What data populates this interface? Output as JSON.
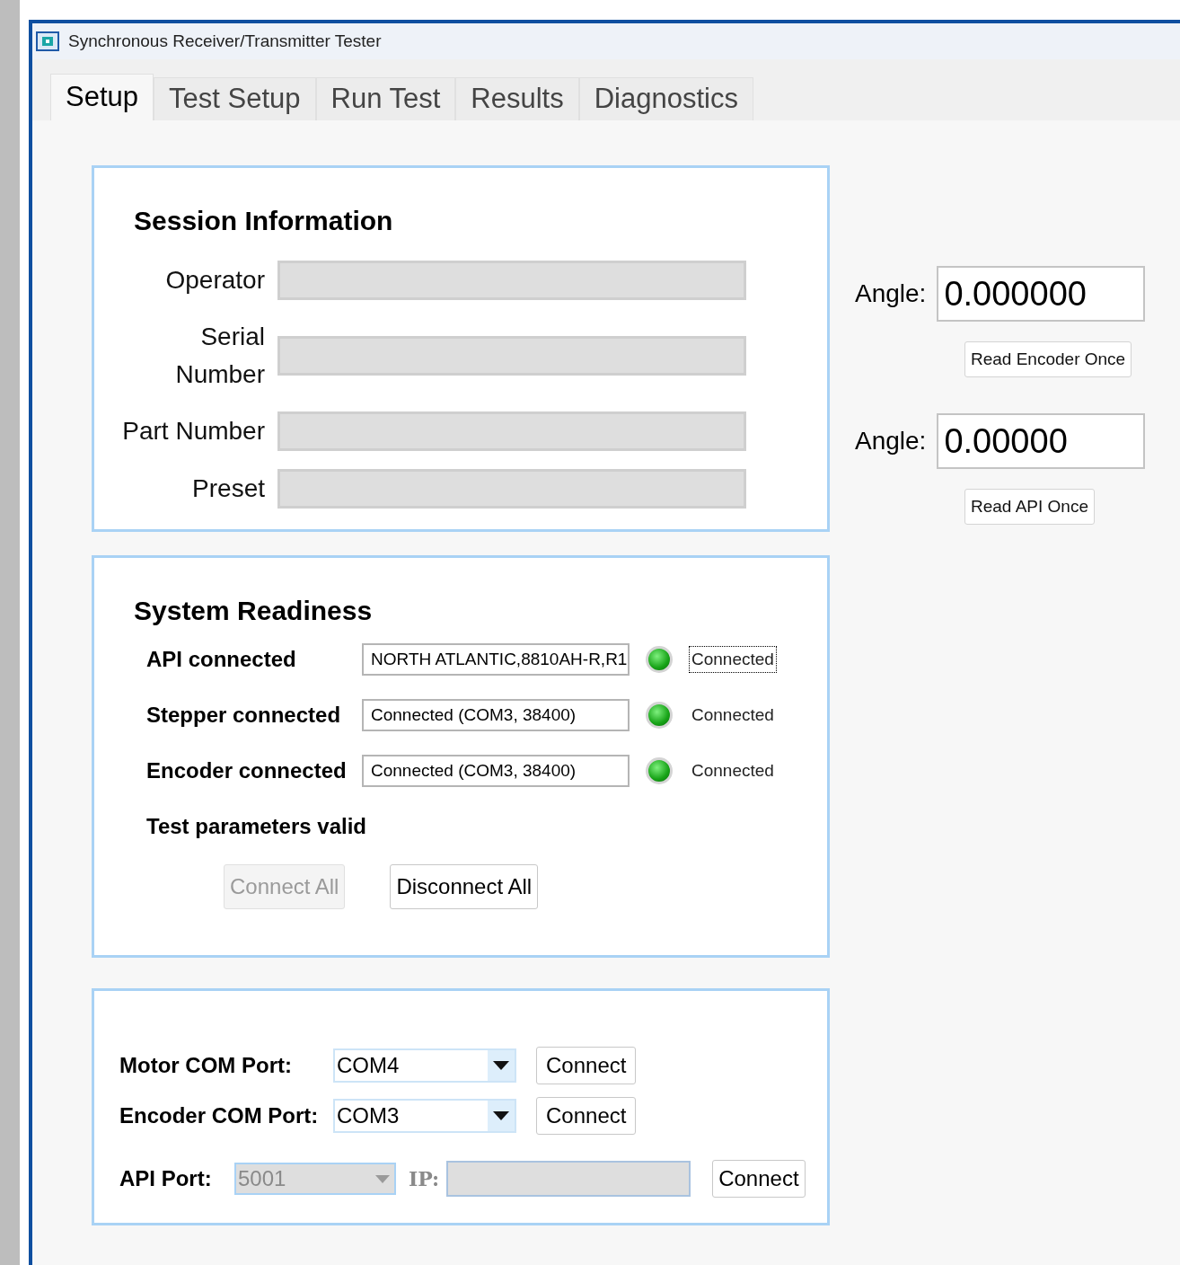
{
  "window": {
    "title": "Synchronous Receiver/Transmitter Tester"
  },
  "tabs": [
    {
      "label": "Setup",
      "selected": true
    },
    {
      "label": "Test Setup",
      "selected": false
    },
    {
      "label": "Run Test",
      "selected": false
    },
    {
      "label": "Results",
      "selected": false
    },
    {
      "label": "Diagnostics",
      "selected": false
    }
  ],
  "session": {
    "title": "Session Information",
    "fields": [
      {
        "label": "Operator",
        "disabled": true
      },
      {
        "label": "Serial Number",
        "disabled": true
      },
      {
        "label": "Part Number",
        "disabled": true
      },
      {
        "label": "Preset",
        "disabled": true
      }
    ]
  },
  "readiness": {
    "title": "System Readiness",
    "rows": [
      {
        "kind": "status",
        "label": "API connected",
        "value": "NORTH ATLANTIC,8810AH-R,R1",
        "on": true,
        "status": "Connected",
        "focused": true
      },
      {
        "kind": "status",
        "label": "Stepper connected",
        "value": "Connected (COM3, 38400)",
        "on": true,
        "status": "Connected",
        "focused": false
      },
      {
        "kind": "status",
        "label": "Encoder connected",
        "value": "Connected (COM3, 38400)",
        "on": true,
        "status": "Connected",
        "focused": false
      },
      {
        "kind": "label",
        "label": "Test parameters valid"
      }
    ],
    "buttons": [
      {
        "label": "Connect All",
        "disabled": true
      },
      {
        "label": "Disconnect All",
        "disabled": false
      }
    ]
  },
  "ports": {
    "rows": [
      {
        "label": "Motor COM Port:",
        "value": "COM4",
        "button": "Connect",
        "disabled": false
      },
      {
        "label": "Encoder COM Port:",
        "value": "COM3",
        "button": "Connect",
        "disabled": false
      }
    ],
    "api": {
      "label": "API Port:",
      "value": "5001",
      "disabled": true,
      "ip_label": "IP:",
      "button": "Connect"
    }
  },
  "readouts": [
    {
      "label": "Angle:",
      "value": "0.000000",
      "button": "Read Encoder Once"
    },
    {
      "label": "Angle:",
      "value": "0.00000",
      "button": "Read API Once"
    }
  ]
}
